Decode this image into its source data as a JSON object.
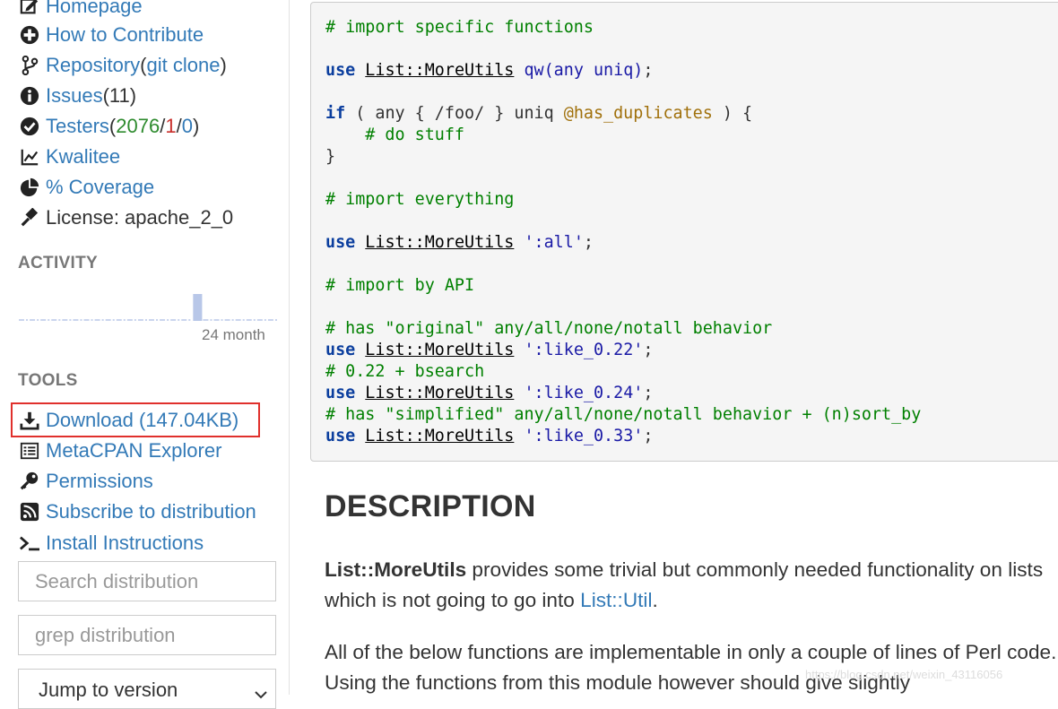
{
  "sidebar": {
    "homepage": "Homepage",
    "contribute": "How to Contribute",
    "repository": "Repository",
    "repo_open": " (",
    "git_clone": "git clone",
    "repo_close": ")",
    "issues": "Issues",
    "issues_count": " (11)",
    "testers": "Testers",
    "testers_open": " (",
    "testers_pass": "2076",
    "sep1": " / ",
    "testers_fail": "1",
    "sep2": " / ",
    "testers_na": "0",
    "testers_close": ")",
    "kwalitee": "Kwalitee",
    "coverage": "% Coverage",
    "license": "License: apache_2_0",
    "activity_title": "ACTIVITY",
    "activity_period": "24 month",
    "tools_title": "TOOLS",
    "download": "Download (147.04KB)",
    "explorer": "MetaCPAN Explorer",
    "permissions": "Permissions",
    "subscribe": "Subscribe to distribution",
    "install": "Install Instructions",
    "search_placeholder": "Search distribution",
    "grep_placeholder": "grep distribution",
    "jump_version": "Jump to version"
  },
  "activity_levels": [
    0,
    0,
    0,
    0,
    0,
    0,
    0,
    0,
    0,
    0,
    0,
    0,
    0,
    0,
    0,
    0,
    1,
    0,
    0,
    0,
    0,
    0,
    0,
    0
  ],
  "code": {
    "c1": "# import specific functions",
    "use": "use",
    "module": "List::MoreUtils",
    "qw": "qw(any uniq)",
    "semi": ";",
    "if": "if",
    "if_body1": " ( any { /foo/ } uniq ",
    "if_var": "@has_duplicates",
    "if_body2": " ) {",
    "do_stuff": "    # do stuff",
    "close_brace": "}",
    "c2": "# import everything",
    "all": "':all'",
    "c3": "# import by API",
    "c4": "# has \"original\" any/all/none/notall behavior",
    "like022": "':like_0.22'",
    "c5": "# 0.22 + bsearch",
    "like024": "':like_0.24'",
    "c6": "# has \"simplified\" any/all/none/notall behavior + (n)sort_by",
    "like033": "':like_0.33'"
  },
  "description": {
    "title": "DESCRIPTION",
    "p1_bold": "List::MoreUtils",
    "p1_text": " provides some trivial but commonly needed functionality on lists which is not going to go into ",
    "p1_link": "List::Util",
    "p1_end": ".",
    "p2": "All of the below functions are implementable in only a couple of lines of Perl code. Using the functions from this module however should give slightly"
  },
  "watermark": "https://blog.csdn.net/weixin_43116056",
  "colors": {
    "link": "#337ab7",
    "highlight_border": "#e0302c",
    "pass": "#2e8b2e",
    "fail": "#c9302c"
  }
}
